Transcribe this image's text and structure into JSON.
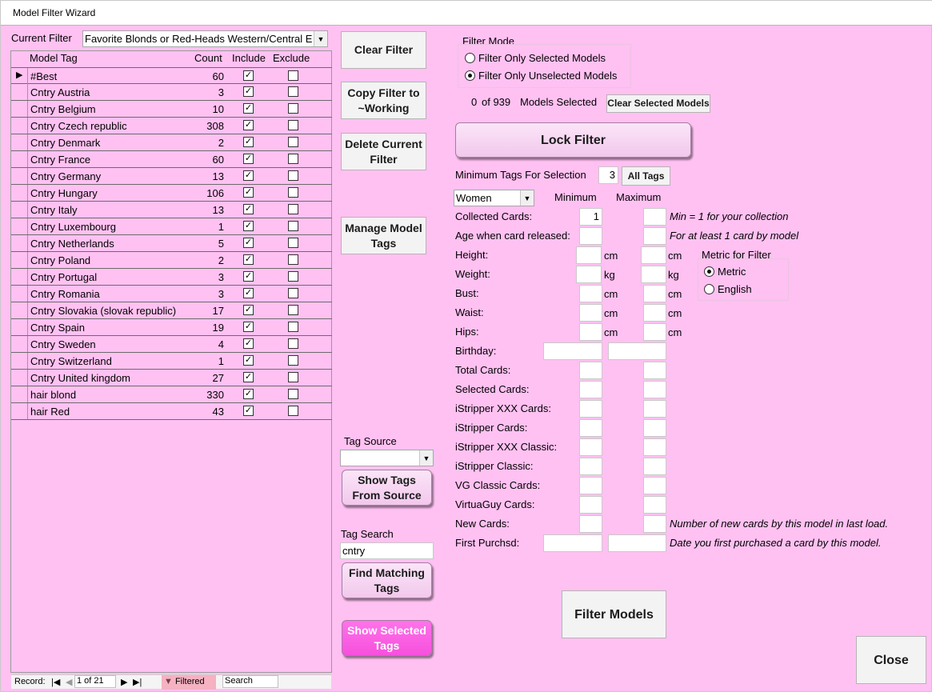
{
  "window": {
    "title": "Model Filter Wizard"
  },
  "filter": {
    "current_label": "Current Filter",
    "current_value": "Favorite Blonds or Red-Heads Western/Central Europe"
  },
  "grid": {
    "headers": {
      "tag": "Model Tag",
      "count": "Count",
      "include": "Include",
      "exclude": "Exclude"
    },
    "rows": [
      {
        "tag": "#Best",
        "count": "60",
        "include": true,
        "exclude": false
      },
      {
        "tag": "Cntry Austria",
        "count": "3",
        "include": true,
        "exclude": false
      },
      {
        "tag": "Cntry Belgium",
        "count": "10",
        "include": true,
        "exclude": false
      },
      {
        "tag": "Cntry Czech republic",
        "count": "308",
        "include": true,
        "exclude": false
      },
      {
        "tag": "Cntry Denmark",
        "count": "2",
        "include": true,
        "exclude": false
      },
      {
        "tag": "Cntry France",
        "count": "60",
        "include": true,
        "exclude": false
      },
      {
        "tag": "Cntry Germany",
        "count": "13",
        "include": true,
        "exclude": false
      },
      {
        "tag": "Cntry Hungary",
        "count": "106",
        "include": true,
        "exclude": false
      },
      {
        "tag": "Cntry Italy",
        "count": "13",
        "include": true,
        "exclude": false
      },
      {
        "tag": "Cntry Luxembourg",
        "count": "1",
        "include": true,
        "exclude": false
      },
      {
        "tag": "Cntry Netherlands",
        "count": "5",
        "include": true,
        "exclude": false
      },
      {
        "tag": "Cntry Poland",
        "count": "2",
        "include": true,
        "exclude": false
      },
      {
        "tag": "Cntry Portugal",
        "count": "3",
        "include": true,
        "exclude": false
      },
      {
        "tag": "Cntry Romania",
        "count": "3",
        "include": true,
        "exclude": false
      },
      {
        "tag": "Cntry Slovakia (slovak republic)",
        "count": "17",
        "include": true,
        "exclude": false
      },
      {
        "tag": "Cntry Spain",
        "count": "19",
        "include": true,
        "exclude": false
      },
      {
        "tag": "Cntry Sweden",
        "count": "4",
        "include": true,
        "exclude": false
      },
      {
        "tag": "Cntry Switzerland",
        "count": "1",
        "include": true,
        "exclude": false
      },
      {
        "tag": "Cntry United kingdom",
        "count": "27",
        "include": true,
        "exclude": false
      },
      {
        "tag": "hair blond",
        "count": "330",
        "include": true,
        "exclude": false
      },
      {
        "tag": "hair Red",
        "count": "43",
        "include": true,
        "exclude": false
      }
    ]
  },
  "navbar": {
    "record_label": "Record:",
    "position": "1 of 21",
    "filtered": "Filtered",
    "search": "Search"
  },
  "buttons": {
    "clear_filter": "Clear Filter",
    "copy_filter": "Copy Filter to ~Working",
    "delete_filter": "Delete Current Filter",
    "manage_tags": "Manage Model Tags",
    "show_tags_source": "Show Tags From Source",
    "find_matching": "Find Matching Tags",
    "show_selected": "Show Selected Tags",
    "lock_filter": "Lock Filter",
    "all_tags": "All Tags",
    "clear_selected_models": "Clear Selected Models",
    "filter_models": "Filter Models",
    "close": "Close"
  },
  "tag_source": {
    "label": "Tag Source",
    "value": ""
  },
  "tag_search": {
    "label": "Tag Search",
    "value": "cntry"
  },
  "filter_mode": {
    "label": "Filter Mode",
    "options": [
      {
        "label": "Filter Only Selected Models",
        "selected": false
      },
      {
        "label": "Filter Only Unselected Models",
        "selected": true
      }
    ]
  },
  "selection": {
    "count": "0",
    "of": "of 939",
    "label": "Models Selected"
  },
  "min_tags": {
    "label": "Minimum Tags For Selection",
    "value": "3"
  },
  "gender": {
    "value": "Women"
  },
  "columns": {
    "minimum": "Minimum",
    "maximum": "Maximum"
  },
  "criteria": {
    "collected_cards": {
      "label": "Collected Cards:",
      "min": "1",
      "max": "",
      "note": "Min = 1 for your collection"
    },
    "age": {
      "label": "Age when card released:",
      "min": "",
      "max": "",
      "note": "For at least 1 card by model"
    },
    "height": {
      "label": "Height:",
      "unit_min": "cm",
      "unit_max": "cm"
    },
    "weight": {
      "label": "Weight:",
      "unit_min": "kg",
      "unit_max": "kg"
    },
    "bust": {
      "label": "Bust:",
      "unit_min": "cm",
      "unit_max": "cm"
    },
    "waist": {
      "label": "Waist:",
      "unit_min": "cm",
      "unit_max": "cm"
    },
    "hips": {
      "label": "Hips:",
      "unit_min": "cm",
      "unit_max": "cm"
    },
    "birthday": {
      "label": "Birthday:"
    },
    "total_cards": {
      "label": "Total Cards:"
    },
    "selected_cards": {
      "label": "Selected Cards:"
    },
    "istripper_xxx": {
      "label": "iStripper XXX Cards:"
    },
    "istripper": {
      "label": "iStripper Cards:"
    },
    "istripper_xxx_classic": {
      "label": "iStripper XXX Classic:"
    },
    "istripper_classic": {
      "label": "iStripper Classic:"
    },
    "vg_classic": {
      "label": "VG Classic Cards:"
    },
    "virtuaguy": {
      "label": "VirtuaGuy Cards:"
    },
    "new_cards": {
      "label": "New Cards:",
      "note": "Number of new cards by this model in last load."
    },
    "first_purch": {
      "label": "First Purchsd:",
      "note": "Date you first purchased a card by this model."
    }
  },
  "metric": {
    "label": "Metric for Filter",
    "options": [
      {
        "label": "Metric",
        "selected": true
      },
      {
        "label": "English",
        "selected": false
      }
    ]
  }
}
